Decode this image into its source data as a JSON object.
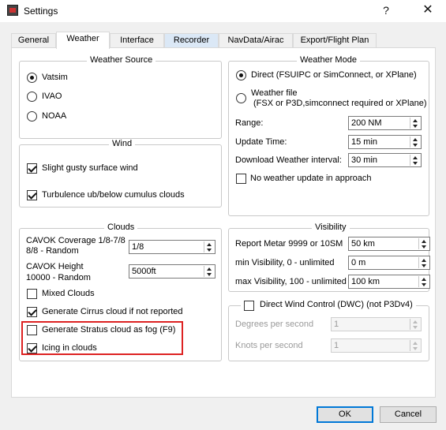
{
  "window": {
    "title": "Settings",
    "help_glyph": "?",
    "close_glyph": "✕"
  },
  "tabs": [
    {
      "label": "General"
    },
    {
      "label": "Weather"
    },
    {
      "label": "Interface"
    },
    {
      "label": "Recorder"
    },
    {
      "label": "NavData/Airac"
    },
    {
      "label": "Export/Flight Plan"
    }
  ],
  "weather_source": {
    "legend": "Weather Source",
    "options": [
      {
        "label": "Vatsim",
        "selected": true
      },
      {
        "label": "IVAO",
        "selected": false
      },
      {
        "label": "NOAA",
        "selected": false
      }
    ]
  },
  "wind": {
    "legend": "Wind",
    "options": [
      {
        "label": "Slight gusty surface wind",
        "checked": true
      },
      {
        "label": "Turbulence ub/below cumulus clouds",
        "checked": true
      }
    ]
  },
  "clouds": {
    "legend": "Clouds",
    "cavok_coverage_label_1": "CAVOK Coverage 1/8-7/8",
    "cavok_coverage_label_2": "8/8 - Random",
    "cavok_coverage_value": "1/8",
    "cavok_height_label_1": "CAVOK Height",
    "cavok_height_label_2": "10000 - Random",
    "cavok_height_value": "5000ft",
    "options": [
      {
        "label": "Mixed Clouds",
        "checked": false
      },
      {
        "label": "Generate Cirrus cloud if not reported",
        "checked": true
      },
      {
        "label": "Generate Stratus cloud as fog (F9)",
        "checked": false
      },
      {
        "label": "Icing in clouds",
        "checked": true
      }
    ]
  },
  "weather_mode": {
    "legend": "Weather Mode",
    "direct_label": "Direct (FSUIPC or SimConnect, or XPlane)",
    "weather_file_label_1": "Weather file",
    "weather_file_label_2": "(FSX or P3D,simconnect required or XPlane)",
    "range_label": "Range:",
    "range_value": "200 NM",
    "update_time_label": "Update Time:",
    "update_time_value": "15 min",
    "download_label": "Download Weather interval:",
    "download_value": "30 min",
    "no_update_label": "No weather update in approach"
  },
  "visibility": {
    "legend": "Visibility",
    "report_label": "Report Metar 9999 or 10SM",
    "report_value": "50 km",
    "min_label": "min Visibility, 0 - unlimited",
    "min_value": "0 m",
    "max_label": "max Visibility, 100 - unlimited",
    "max_value": "100 km"
  },
  "dwc": {
    "legend": "Direct Wind Control (DWC) (not P3Dv4)",
    "degrees_label": "Degrees per second",
    "degrees_value": "1",
    "knots_label": "Knots per second",
    "knots_value": "1"
  },
  "buttons": {
    "ok": "OK",
    "cancel": "Cancel"
  }
}
